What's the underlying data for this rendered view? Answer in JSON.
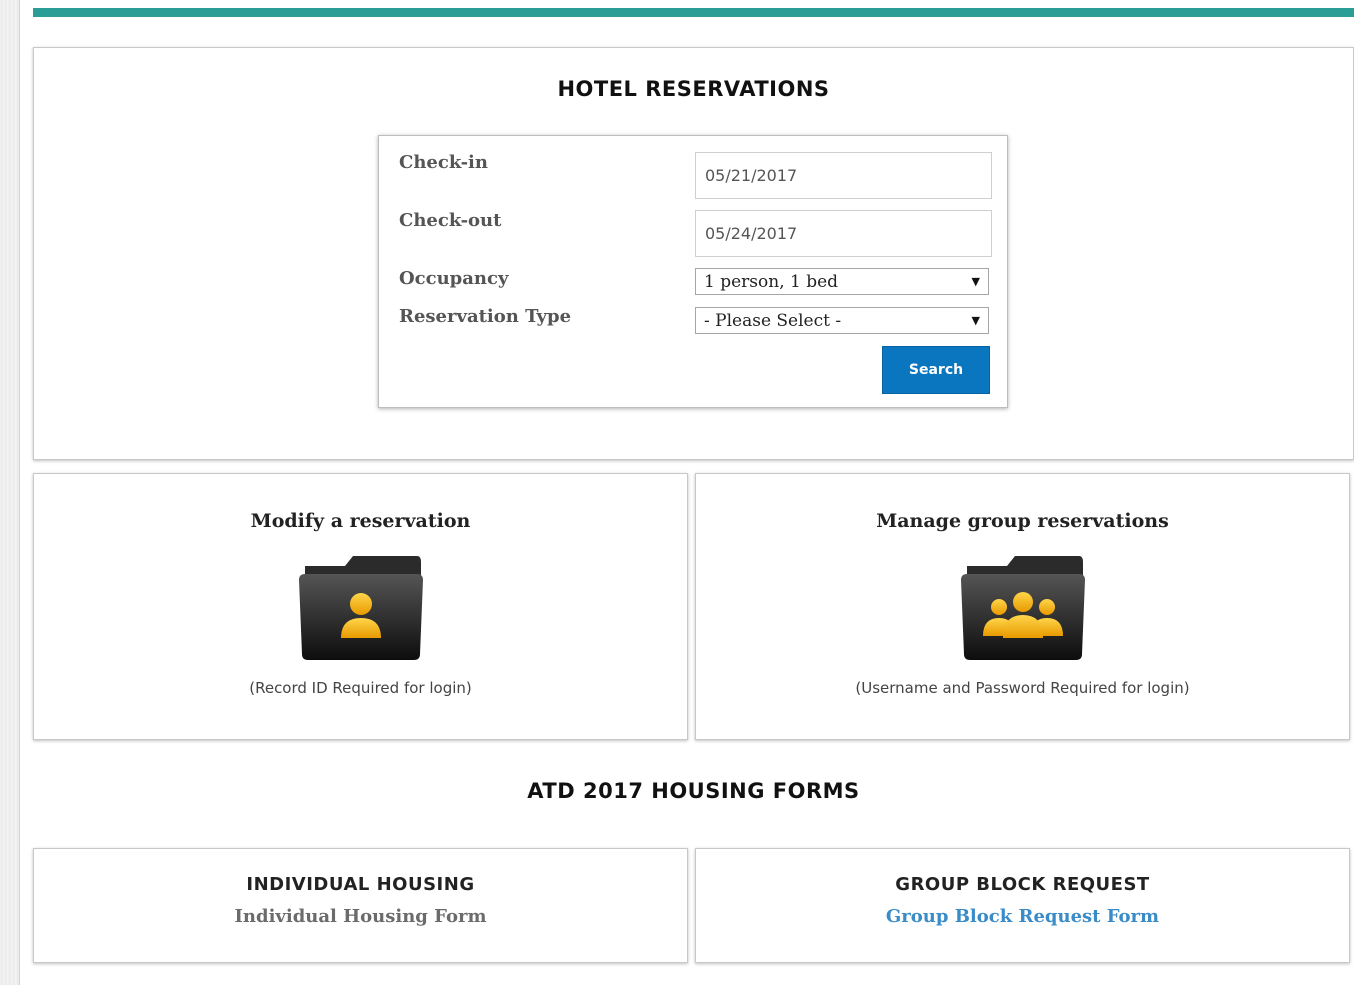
{
  "colors": {
    "accent_bar": "#2a9d96",
    "search_button": "#0b76c0",
    "link_individual": "#6b6b6b",
    "link_group": "#3a8cc8",
    "folder_body": "#1d1d1d",
    "person_icon": "#f4b400"
  },
  "hotel": {
    "title": "HOTEL RESERVATIONS",
    "checkin_label": "Check-in",
    "checkin_value": "05/21/2017",
    "checkout_label": "Check-out",
    "checkout_value": "05/24/2017",
    "occupancy_label": "Occupancy",
    "occupancy_value": "1 person, 1 bed",
    "reservation_type_label": "Reservation Type",
    "reservation_type_value": "- Please Select -",
    "search_label": "Search"
  },
  "modify": {
    "title": "Modify a reservation",
    "icon": "single-user-folder-icon",
    "note": "(Record ID Required for login)"
  },
  "group": {
    "title": "Manage group reservations",
    "icon": "group-users-folder-icon",
    "note": "(Username and Password Required for login)"
  },
  "forms": {
    "title": "ATD 2017 HOUSING FORMS",
    "individual_heading": "INDIVIDUAL HOUSING",
    "individual_link": "Individual Housing Form",
    "group_heading": "GROUP BLOCK REQUEST",
    "group_link": "Group Block Request Form"
  }
}
